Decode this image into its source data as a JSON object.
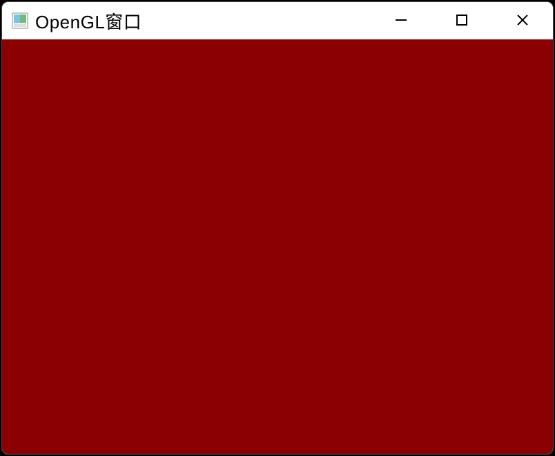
{
  "window": {
    "title": "OpenGL窗口",
    "icons": {
      "app": "app-icon",
      "minimize": "minimize-icon",
      "maximize": "maximize-icon",
      "close": "close-icon"
    },
    "content": {
      "background_color": "#8b0000"
    }
  }
}
